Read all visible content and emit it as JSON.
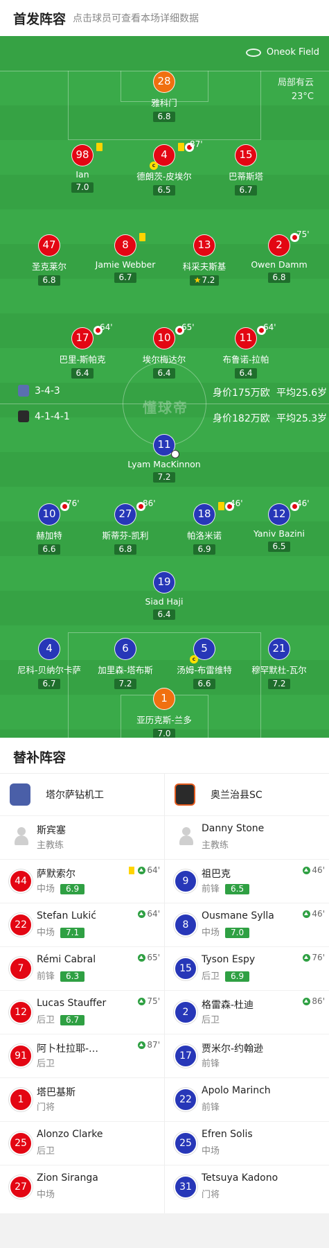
{
  "header": {
    "title": "首发阵容",
    "subtitle": "点击球员可查看本场详细数据"
  },
  "pitch": {
    "venue": "Oneok Field",
    "weather": "局部有云",
    "temperature": "23°C",
    "watermark": "懂球帝",
    "home_form": {
      "formation": "3-4-3",
      "value": "身价175万欧",
      "age": "平均25.6岁"
    },
    "away_form": {
      "formation": "4-1-4-1",
      "value": "身价182万欧",
      "age": "平均25.3岁"
    },
    "home_players": [
      {
        "num": "28",
        "name": "雅科门",
        "rating": "6.8"
      },
      {
        "num": "98",
        "name": "Ian",
        "rating": "7.0"
      },
      {
        "num": "4",
        "name": "德朗茨-皮埃尔",
        "rating": "6.5",
        "minute": "87'"
      },
      {
        "num": "15",
        "name": "巴蒂斯塔",
        "rating": "6.7"
      },
      {
        "num": "47",
        "name": "圣克莱尔",
        "rating": "6.8"
      },
      {
        "num": "8",
        "name": "Jamie Webber",
        "rating": "6.7"
      },
      {
        "num": "13",
        "name": "科采夫斯基",
        "rating": "7.2"
      },
      {
        "num": "2",
        "name": "Owen Damm",
        "rating": "6.8",
        "minute": "75'"
      },
      {
        "num": "17",
        "name": "巴里-斯帕克",
        "rating": "6.4",
        "minute": "64'"
      },
      {
        "num": "10",
        "name": "埃尔梅达尔",
        "rating": "6.4",
        "minute": "65'"
      },
      {
        "num": "11",
        "name": "布鲁诺-拉帕",
        "rating": "6.4",
        "minute": "64'"
      }
    ],
    "away_players": [
      {
        "num": "11",
        "name": "Lyam MacKinnon",
        "rating": "7.2"
      },
      {
        "num": "10",
        "name": "赫加特",
        "rating": "6.6",
        "minute": "76'"
      },
      {
        "num": "27",
        "name": "斯蒂芬-凯利",
        "rating": "6.8",
        "minute": "86'"
      },
      {
        "num": "18",
        "name": "帕洛米诺",
        "rating": "6.9",
        "minute": "46'"
      },
      {
        "num": "12",
        "name": "Yaniv Bazini",
        "rating": "6.5",
        "minute": "46'"
      },
      {
        "num": "19",
        "name": "Siad Haji",
        "rating": "6.4"
      },
      {
        "num": "4",
        "name": "尼科-贝纳尔卡萨",
        "rating": "6.7"
      },
      {
        "num": "6",
        "name": "加里森-塔布斯",
        "rating": "7.2"
      },
      {
        "num": "5",
        "name": "汤姆-布雷维特",
        "rating": "6.6"
      },
      {
        "num": "21",
        "name": "穆罕默杜-瓦尔",
        "rating": "7.2"
      },
      {
        "num": "1",
        "name": "亚历克斯-兰多",
        "rating": "7.0"
      }
    ]
  },
  "subs_section": {
    "title": "替补阵容"
  },
  "home_team": {
    "name": "塔尔萨钻机工",
    "coach": {
      "name": "斯宾塞",
      "role": "主教练"
    },
    "subs": [
      {
        "num": "44",
        "name": "萨默索尔",
        "pos": "中场",
        "rating": "6.9",
        "minute": "64'"
      },
      {
        "num": "22",
        "name": "Stefan Lukić",
        "pos": "中场",
        "rating": "7.1",
        "minute": "64'"
      },
      {
        "num": "7",
        "name": "Rémi Cabral",
        "pos": "前锋",
        "rating": "6.3",
        "minute": "65'"
      },
      {
        "num": "12",
        "name": "Lucas Stauffer",
        "pos": "后卫",
        "rating": "6.7",
        "minute": "75'"
      },
      {
        "num": "91",
        "name": "阿卜杜拉耶-…",
        "pos": "后卫",
        "rating": "",
        "minute": "87'"
      },
      {
        "num": "1",
        "name": "塔巴基斯",
        "pos": "门将",
        "rating": "",
        "minute": ""
      },
      {
        "num": "25",
        "name": "Alonzo Clarke",
        "pos": "后卫",
        "rating": "",
        "minute": ""
      },
      {
        "num": "27",
        "name": "Zion Siranga",
        "pos": "中场",
        "rating": "",
        "minute": ""
      }
    ]
  },
  "away_team": {
    "name": "奥兰治县SC",
    "coach": {
      "name": "Danny Stone",
      "role": "主教练"
    },
    "subs": [
      {
        "num": "9",
        "name": "祖巴克",
        "pos": "前锋",
        "rating": "6.5",
        "minute": "46'"
      },
      {
        "num": "8",
        "name": "Ousmane Sylla",
        "pos": "中场",
        "rating": "7.0",
        "minute": "46'"
      },
      {
        "num": "15",
        "name": "Tyson Espy",
        "pos": "后卫",
        "rating": "6.9",
        "minute": "76'"
      },
      {
        "num": "2",
        "name": "格雷森-杜迪",
        "pos": "后卫",
        "rating": "",
        "minute": "86'"
      },
      {
        "num": "17",
        "name": "贾米尔-约翰逊",
        "pos": "前锋",
        "rating": "",
        "minute": ""
      },
      {
        "num": "22",
        "name": "Apolo Marinch",
        "pos": "前锋",
        "rating": "",
        "minute": ""
      },
      {
        "num": "25",
        "name": "Efren Solis",
        "pos": "中场",
        "rating": "",
        "minute": ""
      },
      {
        "num": "31",
        "name": "Tetsuya Kadono",
        "pos": "门将",
        "rating": "",
        "minute": ""
      }
    ]
  },
  "colors": {
    "pitch": "#3aaa49",
    "home": "#e30613",
    "away": "#2737b8",
    "keeper": "#f07010",
    "rating_bg": "#1f6e2c",
    "sub_rating_bg": "#2fa043"
  }
}
